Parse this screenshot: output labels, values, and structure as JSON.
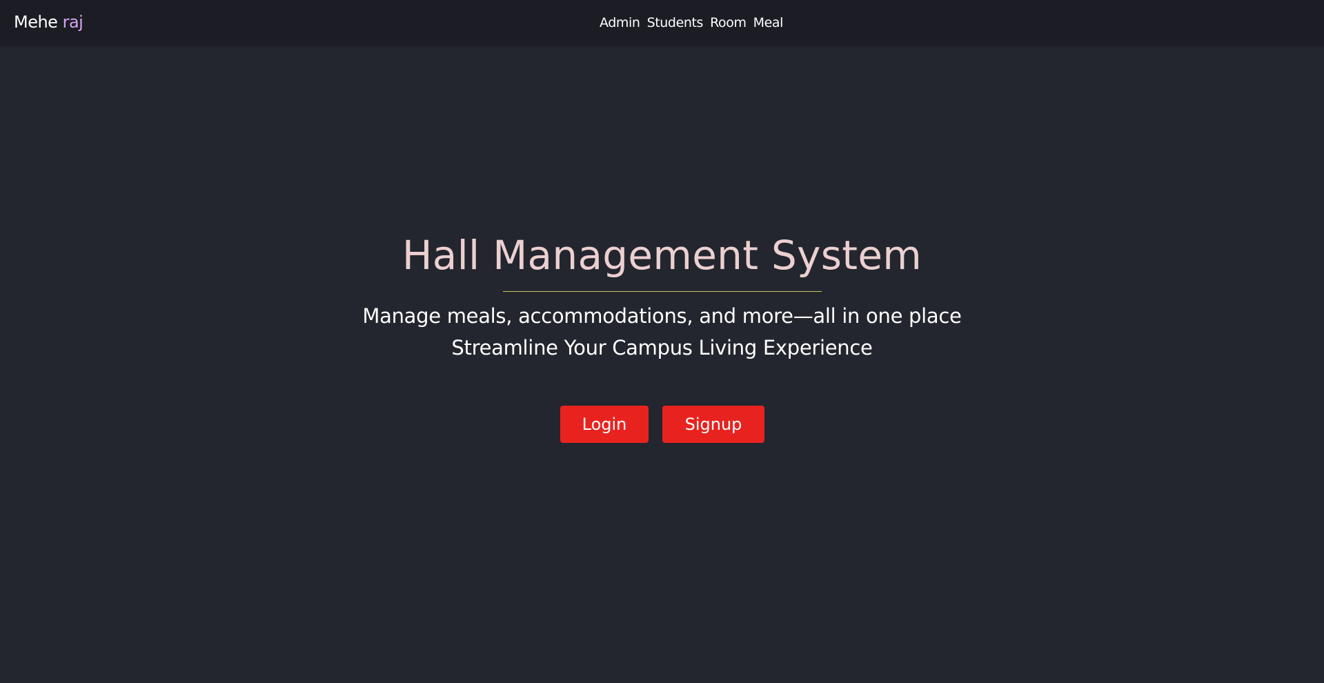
{
  "navbar": {
    "brand_first": "Mehe",
    "brand_second": "raj",
    "links": [
      "Admin",
      "Students",
      "Room",
      "Meal"
    ]
  },
  "hero": {
    "title": "Hall Management System",
    "subtitle_line1": "Manage meals, accommodations, and more—all in one place",
    "subtitle_line2": "Streamline Your Campus Living Experience"
  },
  "buttons": {
    "login_label": "Login",
    "signup_label": "Signup"
  },
  "colors": {
    "background": "#23262e",
    "navbar": "#1b1c24",
    "brand_accent": "#d6a4f0",
    "title": "#ecd0d0",
    "divider": "#c8c864",
    "button": "#e8231f"
  }
}
